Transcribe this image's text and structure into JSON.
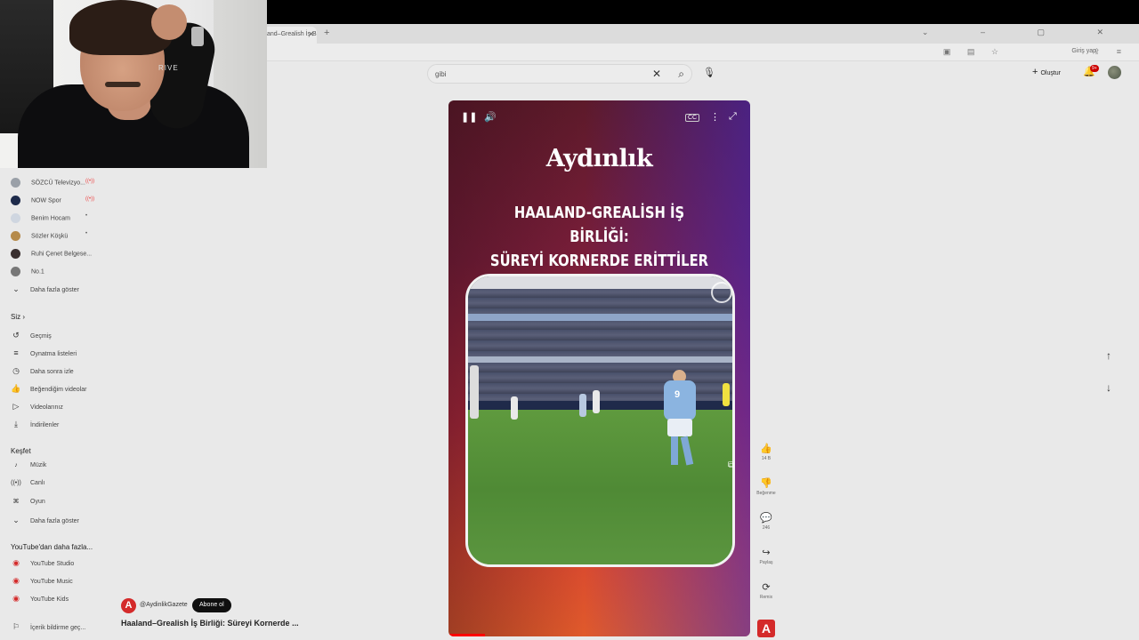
{
  "browser": {
    "tab_title": "and–Grealish İş B",
    "tab_close": "✕",
    "new_tab": "+",
    "window_controls": "⌄ – ▢ ✕",
    "signin_label": "Giriş yap"
  },
  "header": {
    "search_value": "gibi",
    "clear_icon": "✕",
    "search_icon": "⌕",
    "mic_icon": "🎙",
    "create_label": "Oluştur",
    "notifications_badge": "9+"
  },
  "sidebar": {
    "subscriptions": [
      {
        "label": "SÖZCÜ Televizyo...",
        "color": "#9aa0a8",
        "live": true
      },
      {
        "label": "NOW Spor",
        "color": "#1d2a4a",
        "live": true
      },
      {
        "label": "Benim Hocam",
        "color": "#cfd6e0",
        "dot": true
      },
      {
        "label": "Sözler Köşkü",
        "color": "#b58a4a",
        "dot": true
      },
      {
        "label": "Ruhi Çenet Belgese...",
        "color": "#3a3030"
      },
      {
        "label": "No.1",
        "color": "#777777"
      }
    ],
    "show_more_label": "Daha fazla göster",
    "you_heading": "Siz",
    "you_items": [
      {
        "icon": "↺",
        "label": "Geçmiş"
      },
      {
        "icon": "≡",
        "label": "Oynatma listeleri"
      },
      {
        "icon": "◷",
        "label": "Daha sonra izle"
      },
      {
        "icon": "👍",
        "label": "Beğendiğim videolar"
      },
      {
        "icon": "▷",
        "label": "Videolarınız"
      },
      {
        "icon": "⤓",
        "label": "İndirilenler"
      }
    ],
    "explore_heading": "Keşfet",
    "explore_items": [
      {
        "icon": "♪",
        "label": "Müzik"
      },
      {
        "icon": "((•))",
        "label": "Canlı"
      },
      {
        "icon": "⌘",
        "label": "Oyun"
      }
    ],
    "explore_more_label": "Daha fazla göster",
    "more_heading": "YouTube'dan daha fazla...",
    "more_items": [
      {
        "label": "YouTube Studio"
      },
      {
        "label": "YouTube Music"
      },
      {
        "label": "YouTube Kids"
      }
    ],
    "feedback_label": "İçerik bildirme geç..."
  },
  "player": {
    "brand": "Aydınlık",
    "headline_line1": "HAALAND-GREALİSH İŞ BİRLİĞİ:",
    "headline_line2": "SÜREYİ KORNERDE ERİTTİLER",
    "pause_icon": "❚❚",
    "volume_icon": "🔊",
    "cc_icon": "CC",
    "more_icon": "⋮",
    "fullscreen_icon": "⤢",
    "jersey_number": "9",
    "progress_fraction": 0.12
  },
  "actions": {
    "like_icon": "👍",
    "like_count": "14 B",
    "dislike_icon": "👎",
    "dislike_label": "Beğenme",
    "comment_icon": "💬",
    "comment_count": "246",
    "share_icon": "↪",
    "share_label": "Paylaş",
    "remix_icon": "⟳",
    "remix_label": "Remix",
    "channel_letter": "A"
  },
  "nav": {
    "up_icon": "↑",
    "down_icon": "↓"
  },
  "video_meta": {
    "avatar_letter": "A",
    "handle": "@AydinlikGazete",
    "subscribe_label": "Abone ol",
    "title": "Haaland–Grealish İş Birliği: Süreyi Kornerde ..."
  }
}
